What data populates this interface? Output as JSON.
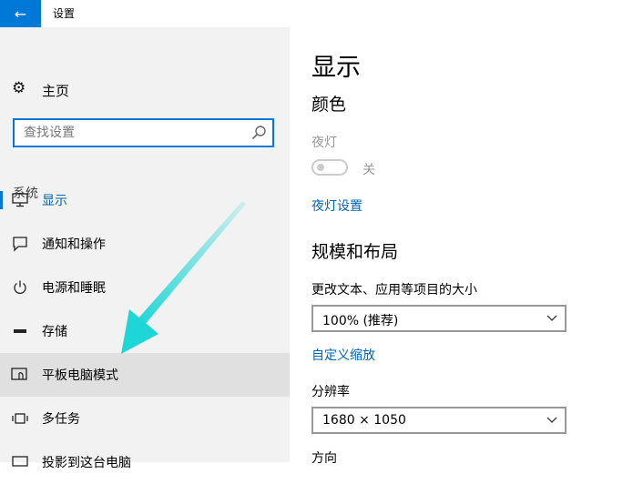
{
  "window": {
    "title": "设置",
    "back_icon": "arrow-left-icon"
  },
  "sidebar": {
    "home": {
      "label": "主页",
      "icon": "gear-icon"
    },
    "search": {
      "placeholder": "查找设置",
      "icon": "search-icon"
    },
    "section_label": "系统",
    "items": [
      {
        "label": "显示",
        "icon": "monitor-icon",
        "state": "active"
      },
      {
        "label": "通知和操作",
        "icon": "speech-bubble-icon",
        "state": "normal"
      },
      {
        "label": "电源和睡眠",
        "icon": "power-icon",
        "state": "normal"
      },
      {
        "label": "存储",
        "icon": "storage-icon",
        "state": "normal"
      },
      {
        "label": "平板电脑模式",
        "icon": "tablet-mode-icon",
        "state": "hover"
      },
      {
        "label": "多任务",
        "icon": "multitasking-icon",
        "state": "normal"
      },
      {
        "label": "投影到这台电脑",
        "icon": "projection-icon",
        "state": "normal"
      }
    ]
  },
  "content": {
    "title": "显示",
    "color_section": "颜色",
    "night_light": {
      "label": "夜灯",
      "state_text": "关"
    },
    "night_light_settings_link": "夜灯设置",
    "scale_section": "规模和布局",
    "scale": {
      "label": "更改文本、应用等项目的大小",
      "value": "100% (推荐)"
    },
    "custom_scaling_link": "自定义缩放",
    "resolution": {
      "label": "分辨率",
      "value": "1680 × 1050"
    },
    "orientation_label": "方向"
  },
  "annotation": {
    "type": "arrow",
    "color": "#1fd6d6"
  },
  "colors": {
    "accent": "#0078d7",
    "sidebar_bg": "#f2f2f2",
    "hover_bg": "#e0e0e0",
    "link": "#0063b1"
  }
}
